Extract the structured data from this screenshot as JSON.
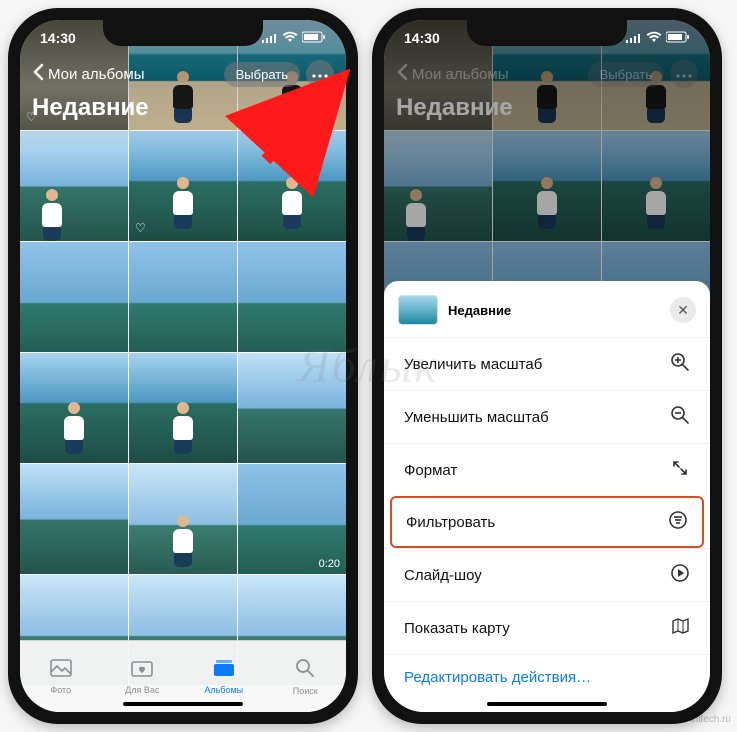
{
  "status": {
    "time": "14:30"
  },
  "header": {
    "back_label": "Мои альбомы",
    "select_label": "Выбрать",
    "album_title": "Недавние"
  },
  "grid": {
    "video_duration": "0:20"
  },
  "tabs": {
    "items": [
      {
        "label": "Фото"
      },
      {
        "label": "Для Вас"
      },
      {
        "label": "Альбомы"
      },
      {
        "label": "Поиск"
      }
    ]
  },
  "sheet": {
    "title": "Недавние",
    "rows": [
      {
        "label": "Увеличить масштаб",
        "icon": "zoom-in"
      },
      {
        "label": "Уменьшить масштаб",
        "icon": "zoom-out"
      },
      {
        "label": "Формат",
        "icon": "aspect"
      },
      {
        "label": "Фильтровать",
        "icon": "filter"
      },
      {
        "label": "Слайд-шоу",
        "icon": "play"
      },
      {
        "label": "Показать карту",
        "icon": "map"
      }
    ],
    "edit_link": "Редактировать действия…"
  },
  "watermark": "Яблык",
  "corner_watermark": "24hitech.ru"
}
